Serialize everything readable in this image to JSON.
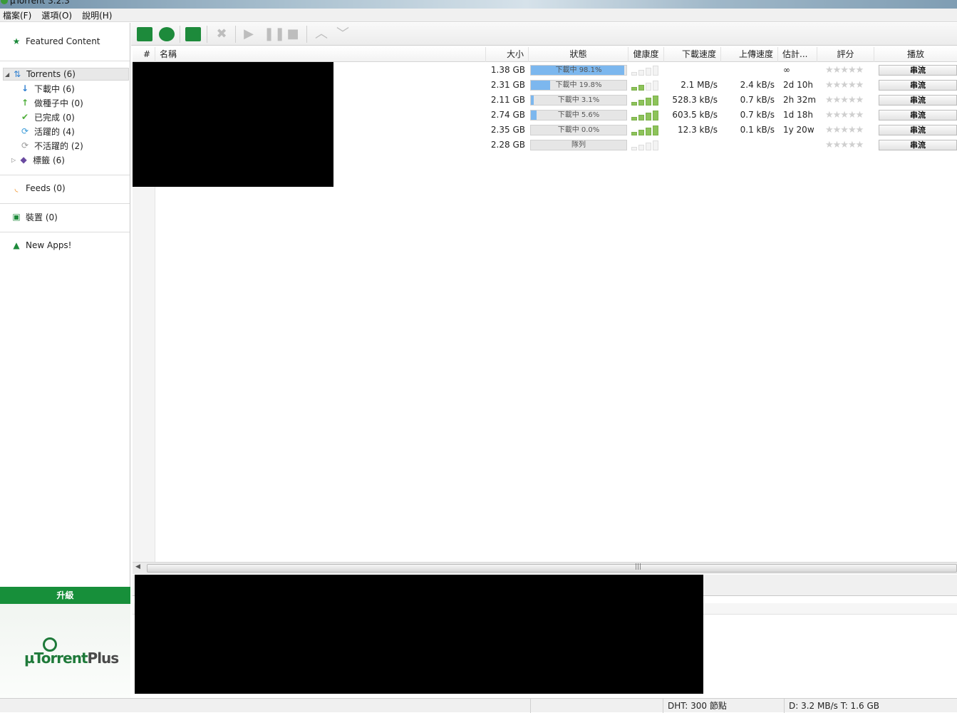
{
  "window": {
    "title": "µTorrent 3.2.3"
  },
  "menu": [
    "檔案(F)",
    "選項(O)",
    "說明(H)"
  ],
  "sidebar": {
    "featured": "Featured Content",
    "torrents": "Torrents (6)",
    "downloading": "下載中 (6)",
    "seeding": "做種子中 (0)",
    "completed": "已完成 (0)",
    "active": "活躍的 (4)",
    "inactive": "不活躍的 (2)",
    "labels": "標籤 (6)",
    "feeds": "Feeds (0)",
    "devices": "裝置 (0)",
    "new_apps": "New Apps!",
    "upgrade": "升級",
    "promo_logo_main": "µTorrent",
    "promo_logo_plus": "Plus"
  },
  "columns": {
    "num": "#",
    "name": "名稱",
    "size": "大小",
    "status": "狀態",
    "health": "健康度",
    "down_speed": "下載速度",
    "up_speed": "上傳速度",
    "eta": "估計...",
    "rating": "評分",
    "play": "播放"
  },
  "torrents": [
    {
      "size": "1.38 GB",
      "status": "下載中 98.1%",
      "progress": 98.1,
      "health_bars": 0,
      "down": "",
      "up": "",
      "eta": "∞",
      "rating": "★★★★★",
      "play": "串流"
    },
    {
      "size": "2.31 GB",
      "status": "下載中 19.8%",
      "progress": 19.8,
      "health_bars": 2,
      "down": "2.1 MB/s",
      "up": "2.4 kB/s",
      "eta": "2d 10h",
      "rating": "★★★★★",
      "play": "串流"
    },
    {
      "size": "2.11 GB",
      "status": "下載中 3.1%",
      "progress": 3.1,
      "health_bars": 4,
      "down": "528.3 kB/s",
      "up": "0.7 kB/s",
      "eta": "2h 32m",
      "rating": "★★★★★",
      "play": "串流"
    },
    {
      "size": "2.74 GB",
      "status": "下載中 5.6%",
      "progress": 5.6,
      "health_bars": 4,
      "down": "603.5 kB/s",
      "up": "0.7 kB/s",
      "eta": "1d 18h",
      "rating": "★★★★★",
      "play": "串流"
    },
    {
      "size": "2.35 GB",
      "status": "下載中 0.0%",
      "progress": 0.0,
      "health_bars": 4,
      "down": "12.3 kB/s",
      "up": "0.1 kB/s",
      "eta": "1y 20w",
      "rating": "★★★★★",
      "play": "串流"
    },
    {
      "size": "2.28 GB",
      "status": "隊列",
      "progress": 0,
      "health_bars": 0,
      "down": "",
      "up": "",
      "eta": "",
      "rating": "★★★★★",
      "play": "串流"
    }
  ],
  "statusbar": {
    "dht": "DHT: 300 節點",
    "transfer": "D: 3.2 MB/s T: 1.6 GB"
  },
  "colors": {
    "progress_fill": "#7cb7ee",
    "health_on": "#8dc35a",
    "brand_green": "#178f3a"
  }
}
